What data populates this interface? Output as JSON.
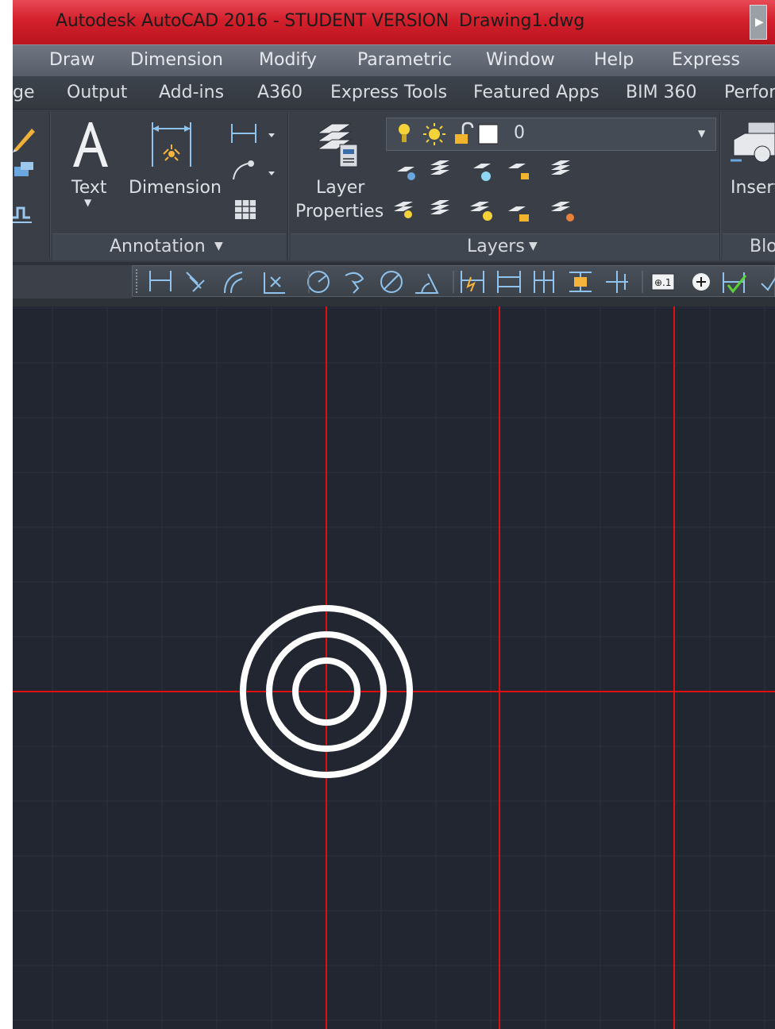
{
  "titlebar": {
    "app_title": "Autodesk AutoCAD 2016 - STUDENT VERSION",
    "file_name": "Drawing1.dwg"
  },
  "menu": [
    "Draw",
    "Dimension",
    "Modify",
    "Parametric",
    "Window",
    "Help",
    "Express"
  ],
  "ribbon_tabs": [
    "ge",
    "Output",
    "Add-ins",
    "A360",
    "Express Tools",
    "Featured Apps",
    "BIM 360",
    "Perfor"
  ],
  "annotation_panel": {
    "text_label": "Text",
    "dimension_label": "Dimension",
    "title": "Annotation"
  },
  "layers_panel": {
    "layer_properties_label_1": "Layer",
    "layer_properties_label_2": "Properties",
    "current_layer": "0",
    "title": "Layers"
  },
  "block_panel": {
    "insert_label": "Insert",
    "title": "Blo"
  },
  "colors": {
    "titlebar": "#d3202c",
    "canvas_background": "#212630",
    "crosshair": "#e01010",
    "circle_stroke": "#ffffff",
    "grid_line": "#2c3340"
  },
  "icons": {
    "text_tool": "large-letter-a-icon",
    "dimension_tool": "dimension-icon",
    "layer_properties": "layer-stack-icon",
    "insert_block": "insert-block-icon"
  }
}
